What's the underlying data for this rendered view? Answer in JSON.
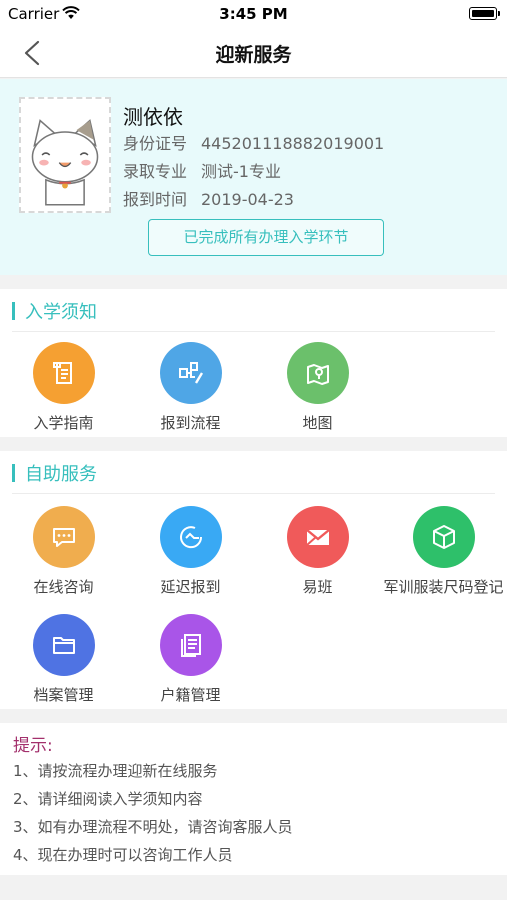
{
  "status_bar": {
    "carrier": "Carrier",
    "time": "3:45 PM"
  },
  "nav": {
    "title": "迎新服务"
  },
  "profile": {
    "name": "测依依",
    "rows": [
      {
        "label": "身份证号",
        "value": "445201118882019001"
      },
      {
        "label": "录取专业",
        "value": "测试-1专业"
      },
      {
        "label": "报到时间",
        "value": "2019-04-23"
      }
    ],
    "status_label": "已完成所有办理入学环节"
  },
  "admission": {
    "title": "入学须知",
    "items": [
      {
        "label": "入学指南",
        "icon": "scroll-icon",
        "color": "#f5a032"
      },
      {
        "label": "报到流程",
        "icon": "flow-icon",
        "color": "#4fa6e6"
      },
      {
        "label": "地图",
        "icon": "map-icon",
        "color": "#6bc06b"
      }
    ]
  },
  "self_service": {
    "title": "自助服务",
    "items": [
      {
        "label": "在线咨询",
        "icon": "chat-icon",
        "color": "#f0ad4e"
      },
      {
        "label": "延迟报到",
        "icon": "clock-icon",
        "color": "#39a9f4"
      },
      {
        "label": "易班",
        "icon": "yiban-icon",
        "color": "#f05a5a"
      },
      {
        "label": "军训服装尺码登记",
        "icon": "box-icon",
        "color": "#2ec06a"
      },
      {
        "label": "档案管理",
        "icon": "folder-icon",
        "color": "#4f73e3"
      },
      {
        "label": "户籍管理",
        "icon": "document-icon",
        "color": "#a955e8"
      }
    ]
  },
  "tips": {
    "title": "提示:",
    "lines": [
      "1、请按流程办理迎新在线服务",
      "2、请详细阅读入学须知内容",
      "3、如有办理流程不明处，请咨询客服人员",
      "4、现在办理时可以咨询工作人员"
    ]
  }
}
